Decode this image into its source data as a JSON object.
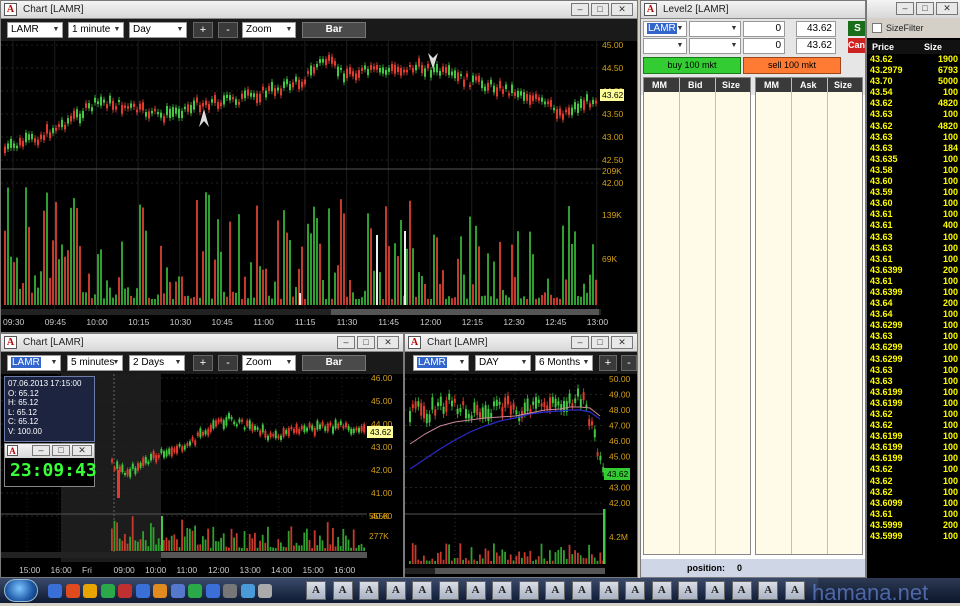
{
  "main_chart": {
    "title": "Chart [LAMR]",
    "symbol": "LAMR",
    "interval": "1 minute",
    "range": "Day",
    "zoom": "Zoom",
    "plus": "+",
    "minus": "-",
    "bar_button": "Bar",
    "last_price": "43.62",
    "price_ticks": [
      "45.00",
      "44.50",
      "44.00",
      "43.50",
      "43.00",
      "42.50",
      "42.00"
    ],
    "volume_ticks": [
      "209K",
      "139K",
      "69K"
    ],
    "time_ticks": [
      "09:30",
      "09:45",
      "10:00",
      "10:15",
      "10:30",
      "10:45",
      "11:00",
      "11:15",
      "11:30",
      "11:45",
      "12:00",
      "12:15",
      "12:30",
      "12:45",
      "13:00"
    ]
  },
  "chart_5min": {
    "title": "Chart [LAMR]",
    "symbol": "LAMR",
    "interval": "5 minutes",
    "range": "2 Days",
    "zoom": "Zoom",
    "plus": "+",
    "minus": "-",
    "bar_button": "Bar",
    "last_price": "43.62",
    "price_ticks": [
      "46.00",
      "45.00",
      "44.00",
      "43.00",
      "42.00",
      "41.00",
      "40.00"
    ],
    "volume_ticks": [
      "555K",
      "277K"
    ],
    "time_ticks": [
      "15:00",
      "16:00",
      "Fri",
      "09:00",
      "10:00",
      "11:00",
      "12:00",
      "13:00",
      "14:00",
      "15:00",
      "16:00"
    ],
    "tooltip": {
      "date": "07.06.2013 17:15:00",
      "o": "O: 65.12",
      "h": "H: 65.12",
      "l": "L: 65.12",
      "c": "C: 65.12",
      "v": "V: 100.00"
    }
  },
  "clock": {
    "time": "23:09:43"
  },
  "chart_daily": {
    "title": "Chart [LAMR]",
    "symbol": "LAMR",
    "interval": "DAY",
    "range": "6 Months",
    "plus": "+",
    "minus": "-",
    "last_price": "43.62",
    "price_ticks": [
      "50.00",
      "49.00",
      "48.00",
      "47.00",
      "46.00",
      "45.00",
      "44.00",
      "43.00",
      "42.00"
    ],
    "volume_ticks": [
      "4.2M"
    ]
  },
  "level2": {
    "title": "Level2 [LAMR]",
    "symbol": "LAMR",
    "qty1": "0",
    "price1": "43.62",
    "qty2": "0",
    "price2": "43.62",
    "btn_s": "S",
    "btn_can": "Can",
    "buy": "buy 100 mkt",
    "sell": "sell 100 mkt",
    "bid_headers": [
      "MM",
      "Bid",
      "Size"
    ],
    "ask_headers": [
      "MM",
      "Ask",
      "Size"
    ],
    "position_label": "position:",
    "position_value": "0"
  },
  "tape": {
    "sizefilter": "SizeFilter",
    "price_header": "Price",
    "size_header": "Size",
    "rows": [
      [
        "43.62",
        "1900"
      ],
      [
        "43.2979",
        "6793"
      ],
      [
        "43.70",
        "5000"
      ],
      [
        "43.54",
        "100"
      ],
      [
        "43.62",
        "4820"
      ],
      [
        "43.63",
        "100"
      ],
      [
        "43.62",
        "4820"
      ],
      [
        "43.63",
        "100"
      ],
      [
        "43.63",
        "184"
      ],
      [
        "43.635",
        "100"
      ],
      [
        "43.58",
        "100"
      ],
      [
        "43.60",
        "100"
      ],
      [
        "43.59",
        "100"
      ],
      [
        "43.60",
        "100"
      ],
      [
        "43.61",
        "100"
      ],
      [
        "43.61",
        "400"
      ],
      [
        "43.63",
        "100"
      ],
      [
        "43.63",
        "100"
      ],
      [
        "43.61",
        "100"
      ],
      [
        "43.6399",
        "200"
      ],
      [
        "43.61",
        "100"
      ],
      [
        "43.6399",
        "100"
      ],
      [
        "43.64",
        "200"
      ],
      [
        "43.64",
        "100"
      ],
      [
        "43.6299",
        "100"
      ],
      [
        "43.63",
        "100"
      ],
      [
        "43.6299",
        "100"
      ],
      [
        "43.6299",
        "100"
      ],
      [
        "43.63",
        "100"
      ],
      [
        "43.63",
        "100"
      ],
      [
        "43.6199",
        "100"
      ],
      [
        "43.6199",
        "100"
      ],
      [
        "43.62",
        "100"
      ],
      [
        "43.62",
        "100"
      ],
      [
        "43.6199",
        "100"
      ],
      [
        "43.6199",
        "100"
      ],
      [
        "43.6199",
        "100"
      ],
      [
        "43.62",
        "100"
      ],
      [
        "43.62",
        "100"
      ],
      [
        "43.62",
        "100"
      ],
      [
        "43.6099",
        "100"
      ],
      [
        "43.61",
        "100"
      ],
      [
        "43.5999",
        "200"
      ],
      [
        "43.5999",
        "100"
      ]
    ]
  },
  "watermark": "hamana.net"
}
